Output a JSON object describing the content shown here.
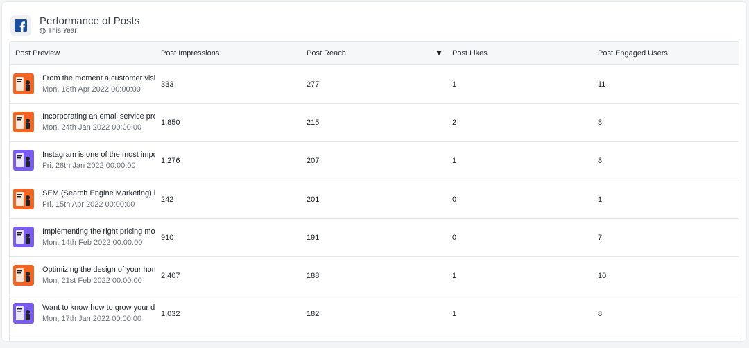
{
  "header": {
    "title": "Performance of Posts",
    "period": "This Year"
  },
  "table": {
    "columns": [
      "Post Preview",
      "Post Impressions",
      "Post Reach",
      "Post Likes",
      "Post Engaged Users"
    ],
    "sorted_column": "Post Reach",
    "sort_direction": "descending",
    "rows": [
      {
        "text": "From the moment a customer visits",
        "date": "Mon, 18th Apr 2022 00:00:00",
        "impressions": "333",
        "reach": "277",
        "likes": "1",
        "engaged": "11",
        "thumb_color": "#f26522"
      },
      {
        "text": "Incorporating an email service provider",
        "date": "Mon, 24th Jan 2022 00:00:00",
        "impressions": "1,850",
        "reach": "215",
        "likes": "2",
        "engaged": "8",
        "thumb_color": "#f26522"
      },
      {
        "text": "Instagram is one of the most important",
        "date": "Fri, 28th Jan 2022 00:00:00",
        "impressions": "1,276",
        "reach": "207",
        "likes": "1",
        "engaged": "8",
        "thumb_color": "#7b5cf0"
      },
      {
        "text": "SEM (Search Engine Marketing) is",
        "date": "Fri, 15th Apr 2022 00:00:00",
        "impressions": "242",
        "reach": "201",
        "likes": "0",
        "engaged": "1",
        "thumb_color": "#f26522"
      },
      {
        "text": "Implementing the right pricing model",
        "date": "Mon, 14th Feb 2022 00:00:00",
        "impressions": "910",
        "reach": "191",
        "likes": "0",
        "engaged": "7",
        "thumb_color": "#7b5cf0"
      },
      {
        "text": "Optimizing the design of your home",
        "date": "Mon, 21st Feb 2022 00:00:00",
        "impressions": "2,407",
        "reach": "188",
        "likes": "1",
        "engaged": "10",
        "thumb_color": "#f26522"
      },
      {
        "text": "Want to know how to grow your d",
        "date": "Mon, 17th Jan 2022 00:00:00",
        "impressions": "1,032",
        "reach": "182",
        "likes": "1",
        "engaged": "8",
        "thumb_color": "#7b5cf0"
      }
    ]
  },
  "colors": {
    "facebook_brand": "#1b4f9c",
    "orange_thumb": "#f26522",
    "purple_thumb": "#7b5cf0"
  },
  "icons": {
    "facebook": "facebook-icon",
    "globe": "globe-icon",
    "sort": "sort-descending-icon"
  }
}
